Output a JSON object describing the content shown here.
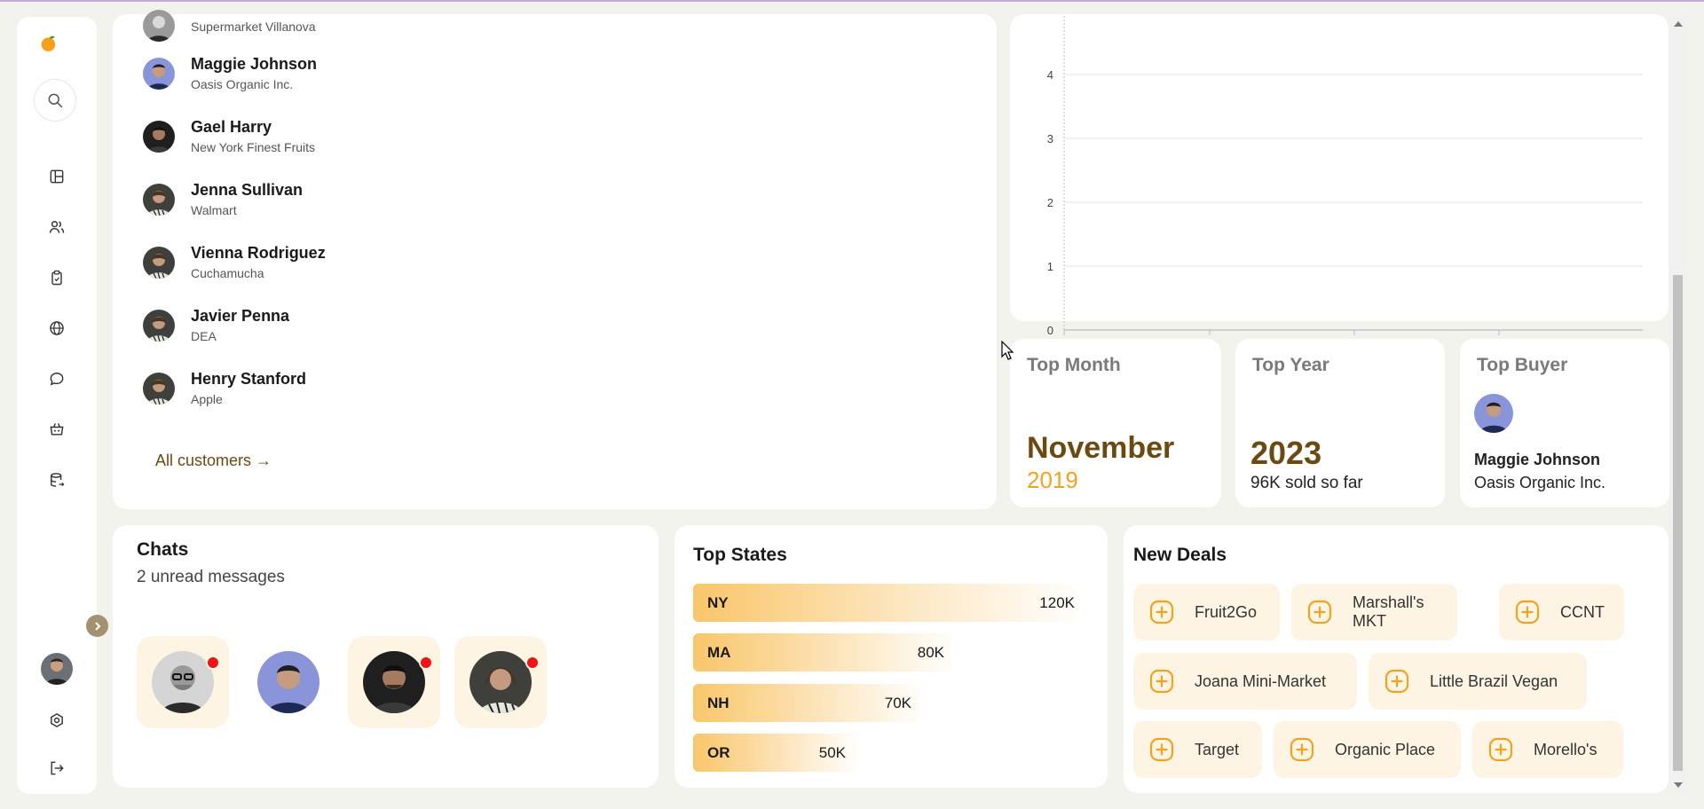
{
  "sidebar": {
    "nav": [
      {
        "icon": "dashboard-icon"
      },
      {
        "icon": "users-icon"
      },
      {
        "icon": "clipboard-icon"
      },
      {
        "icon": "globe-icon"
      },
      {
        "icon": "chat-icon"
      },
      {
        "icon": "basket-icon"
      },
      {
        "icon": "database-icon"
      }
    ],
    "bottom": [
      {
        "icon": "settings-icon"
      },
      {
        "icon": "logout-icon"
      }
    ]
  },
  "customers": {
    "list": [
      {
        "name": "",
        "company": "Supermarket Villanova"
      },
      {
        "name": "Maggie Johnson",
        "company": "Oasis Organic Inc."
      },
      {
        "name": "Gael Harry",
        "company": "New York Finest Fruits"
      },
      {
        "name": "Jenna Sullivan",
        "company": "Walmart"
      },
      {
        "name": "Vienna Rodriguez",
        "company": "Cuchamucha"
      },
      {
        "name": "Javier Penna",
        "company": "DEA"
      },
      {
        "name": "Henry Stanford",
        "company": "Apple"
      }
    ],
    "all_link": "All customers →"
  },
  "chart_data": {
    "type": "line",
    "title": "",
    "xlabel": "",
    "ylabel": "",
    "yticks": [
      0,
      1,
      2,
      3,
      4
    ],
    "ylim": [
      0,
      4
    ],
    "grid": true,
    "series": []
  },
  "stats": {
    "top_month": {
      "title": "Top Month",
      "month": "November",
      "year": "2019"
    },
    "top_year": {
      "title": "Top Year",
      "year": "2023",
      "note": "96K sold so far"
    },
    "top_buyer": {
      "title": "Top Buyer",
      "name": "Maggie Johnson",
      "company": "Oasis Organic Inc."
    }
  },
  "chats": {
    "title": "Chats",
    "subtitle": "2 unread messages"
  },
  "top_states": {
    "title": "Top States",
    "items": [
      {
        "code": "NY",
        "value": "120K"
      },
      {
        "code": "MA",
        "value": "80K"
      },
      {
        "code": "NH",
        "value": "70K"
      },
      {
        "code": "OR",
        "value": "50K"
      }
    ]
  },
  "new_deals": {
    "title": "New Deals",
    "items": [
      "Fruit2Go",
      "Marshall's MKT",
      "CCNT",
      "Joana Mini-Market",
      "Little Brazil Vegan",
      "Target",
      "Organic Place",
      "Morello's"
    ]
  },
  "colors": {
    "accent": "#f0a31e",
    "brown": "#6b4a12",
    "tile": "#fdf4e4",
    "unread": "#f01414"
  }
}
